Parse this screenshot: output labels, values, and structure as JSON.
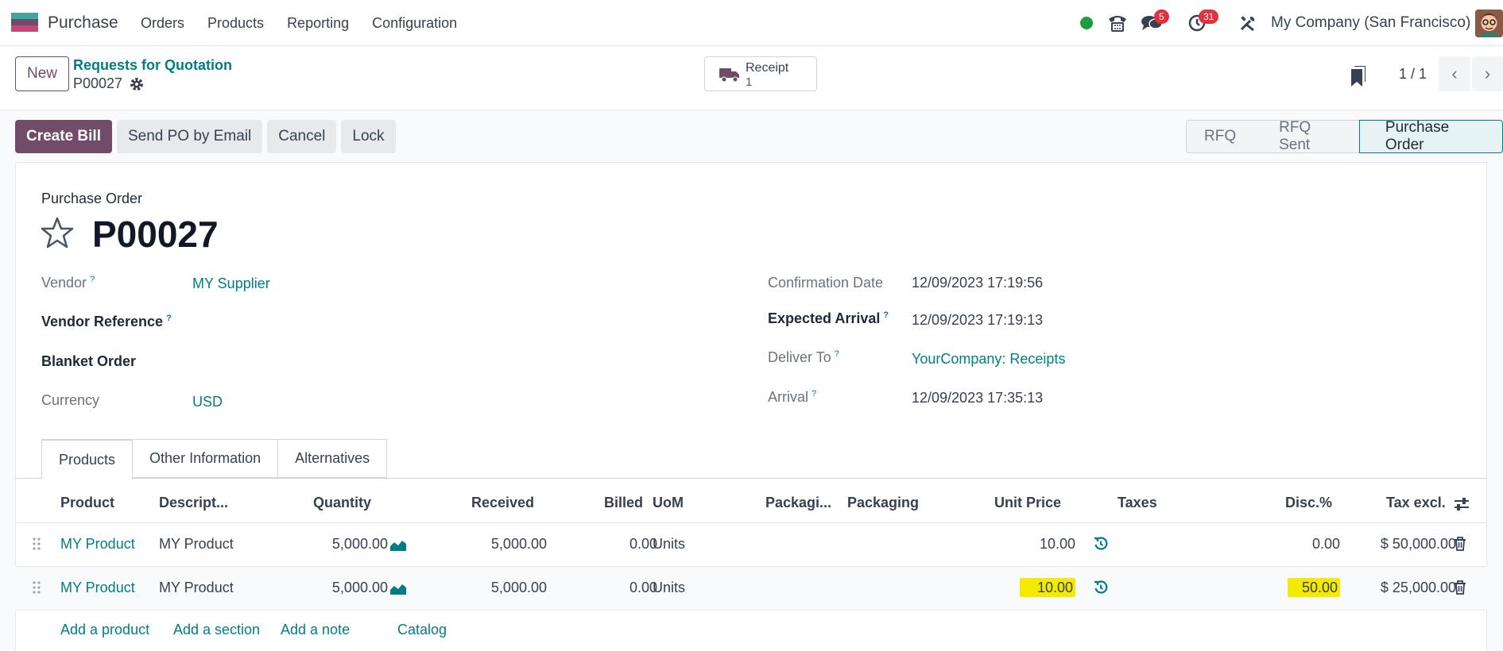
{
  "navbar": {
    "app_name": "Purchase",
    "menu": [
      "Orders",
      "Products",
      "Reporting",
      "Configuration"
    ],
    "messages_count": "5",
    "activities_count": "31",
    "company": "My Company (San Francisco)"
  },
  "control_panel": {
    "new_label": "New",
    "breadcrumb_parent": "Requests for Quotation",
    "breadcrumb_current": "P00027",
    "smart_button": {
      "label": "Receipt",
      "value": "1"
    },
    "pager": "1 / 1"
  },
  "actions": [
    "Create Bill",
    "Send PO by Email",
    "Cancel",
    "Lock"
  ],
  "status_stages": [
    "RFQ",
    "RFQ Sent",
    "Purchase Order"
  ],
  "active_stage": "Purchase Order",
  "form": {
    "doc_type": "Purchase Order",
    "doc_name": "P00027",
    "vendor_label": "Vendor",
    "vendor": "MY Supplier",
    "vendor_ref_label": "Vendor Reference",
    "blanket_label": "Blanket Order",
    "currency_label": "Currency",
    "currency": "USD",
    "confirmation_label": "Confirmation Date",
    "confirmation_date": "12/09/2023 17:19:56",
    "expected_label": "Expected Arrival",
    "expected_arrival": "12/09/2023 17:19:13",
    "deliver_label": "Deliver To",
    "deliver_to": "YourCompany: Receipts",
    "arrival_label": "Arrival",
    "arrival": "12/09/2023 17:35:13",
    "help_mark": "?"
  },
  "tabs": [
    "Products",
    "Other Information",
    "Alternatives"
  ],
  "table": {
    "headers": [
      "Product",
      "Descript...",
      "Quantity",
      "Received",
      "Billed",
      "UoM",
      "Packagi...",
      "Packaging",
      "Unit Price",
      "Taxes",
      "Disc.%",
      "Tax excl."
    ],
    "rows": [
      {
        "product": "MY Product",
        "description": "MY Product",
        "quantity": "5,000.00",
        "received": "5,000.00",
        "billed": "0.00",
        "uom": "Units",
        "unit_price": "10.00",
        "discount": "0.00",
        "subtotal": "$ 50,000.00",
        "highlighted": false
      },
      {
        "product": "MY Product",
        "description": "MY Product",
        "quantity": "5,000.00",
        "received": "5,000.00",
        "billed": "0.00",
        "uom": "Units",
        "unit_price": "10.00",
        "discount": "50.00",
        "subtotal": "$ 25,000.00",
        "highlighted": true
      }
    ],
    "add_links": [
      "Add a product",
      "Add a section",
      "Add a note",
      "Catalog"
    ]
  },
  "colors": {
    "brand": "#714b67",
    "link": "#017e84",
    "highlight": "#f3ea00",
    "badge": "#e0323c",
    "online": "#1f9d3a"
  }
}
